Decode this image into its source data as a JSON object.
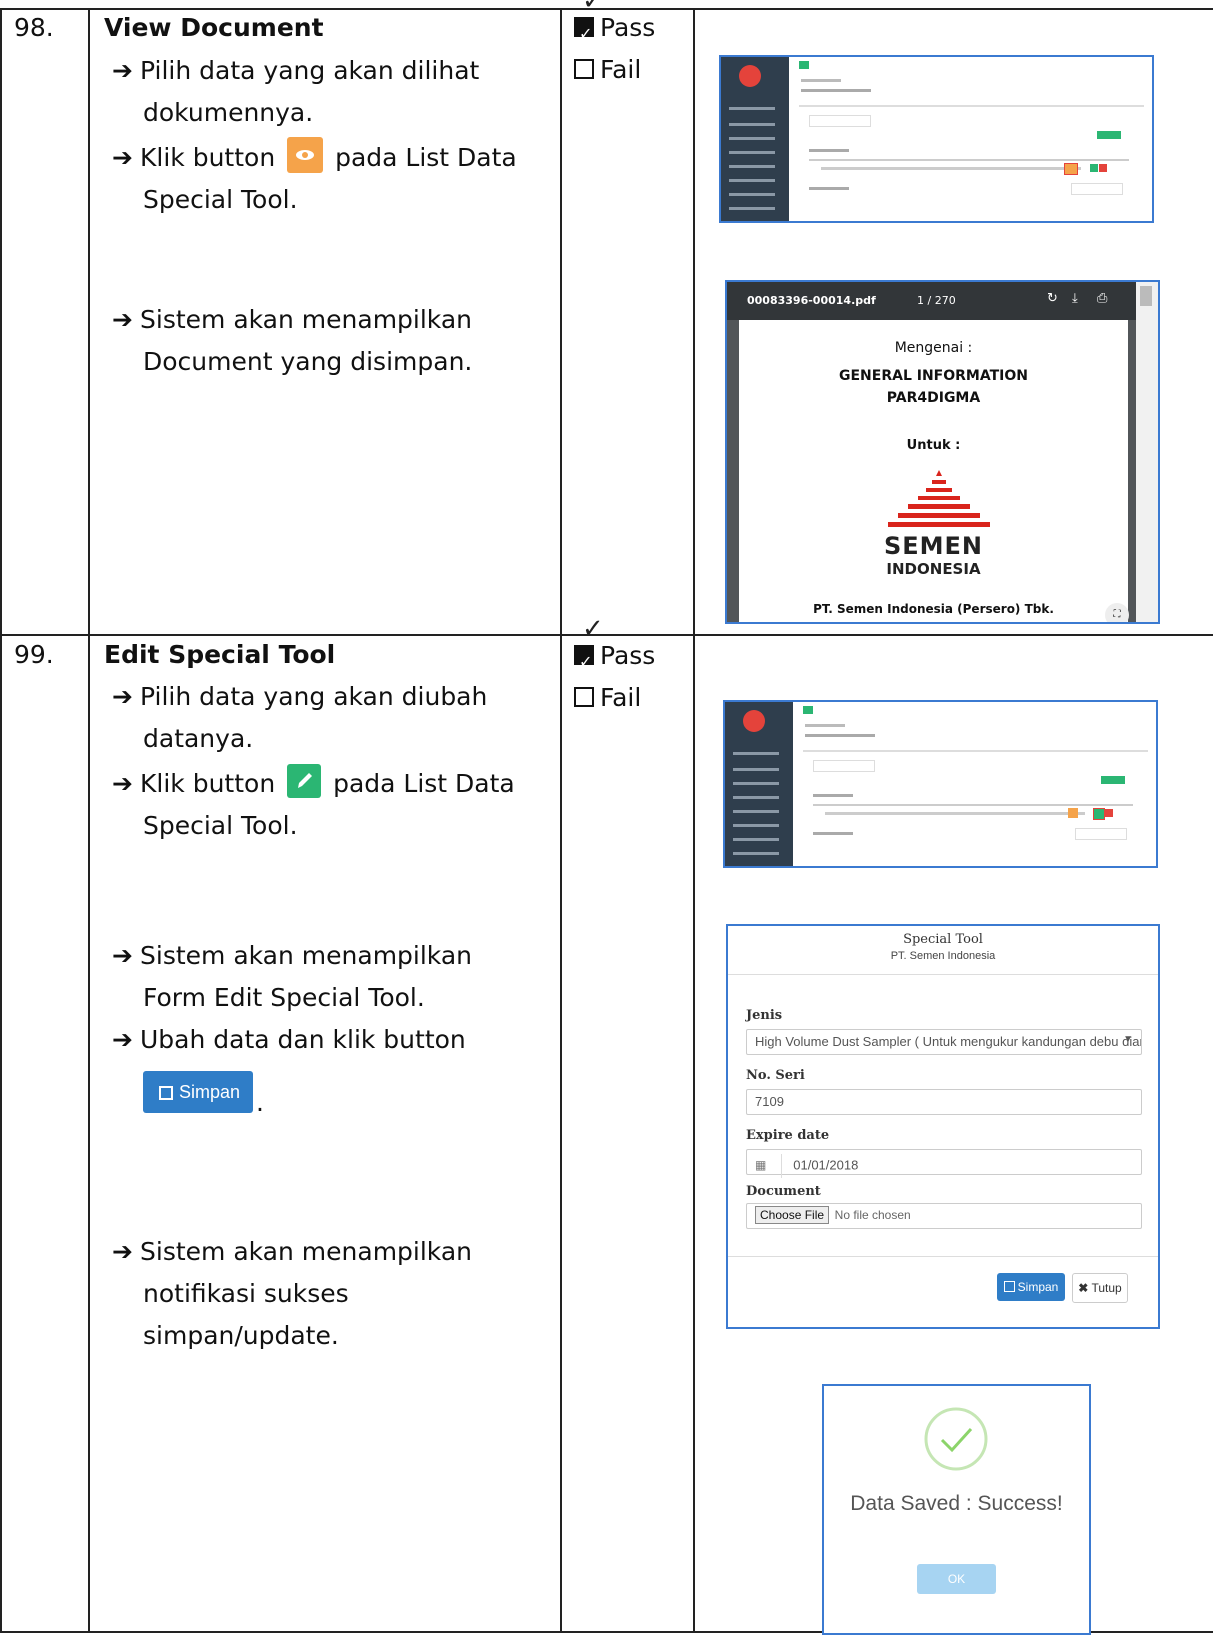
{
  "rows": [
    {
      "number": "98.",
      "title": "View Document",
      "steps": [
        {
          "line1": "Pilih data yang akan dilihat",
          "line2": "dokumennya."
        },
        {
          "line1_a": "Klik button",
          "line1_b": "pada List Data",
          "line2": "Special Tool."
        },
        {
          "line1": "Sistem akan menampilkan",
          "line2": "Document yang disimpan."
        }
      ],
      "pass_label": "Pass",
      "fail_label": "Fail"
    },
    {
      "number": "99.",
      "title": "Edit Special Tool",
      "steps": [
        {
          "line1": "Pilih data yang akan diubah",
          "line2": "datanya."
        },
        {
          "line1_a": "Klik button",
          "line1_b": "pada List Data",
          "line2": "Special Tool."
        },
        {
          "line1": "Sistem akan menampilkan",
          "line2": "Form Edit Special Tool."
        },
        {
          "line1": "Ubah data dan klik button",
          "suffix": "."
        },
        {
          "line1": "Sistem akan menampilkan",
          "line2": "notifikasi sukses",
          "line3": "simpan/update."
        }
      ],
      "pass_label": "Pass",
      "fail_label": "Fail"
    }
  ],
  "inline_simpan_label": "Simpan",
  "pdf": {
    "filename": "00083396-00014.pdf",
    "pages": "1 / 270",
    "mengenai": "Mengenai :",
    "line1": "GENERAL INFORMATION",
    "line2": "PAR4DIGMA",
    "untuk": "Untuk :",
    "logo_top": "SEMEN",
    "logo_bottom": "INDONESIA",
    "company": "PT. Semen Indonesia (Persero) Tbk."
  },
  "form": {
    "title": "Special Tool",
    "subtitle": "PT. Semen Indonesia",
    "jenis_label": "Jenis",
    "jenis_value": "High Volume Dust Sampler ( Untuk mengukur kandungan debu diarea kerja",
    "seri_label": "No. Seri",
    "seri_value": "7109",
    "expire_label": "Expire date",
    "expire_value": "01/01/2018",
    "doc_label": "Document",
    "choose_file": "Choose File",
    "no_file": "No file chosen",
    "simpan": "Simpan",
    "tutup": "Tutup"
  },
  "success": {
    "message": "Data Saved : Success!",
    "ok": "OK"
  },
  "colors": {
    "accent_blue": "#2f7dc7",
    "orange": "#f5a34a",
    "green": "#2bb673",
    "frame": "#3b7ad1"
  }
}
